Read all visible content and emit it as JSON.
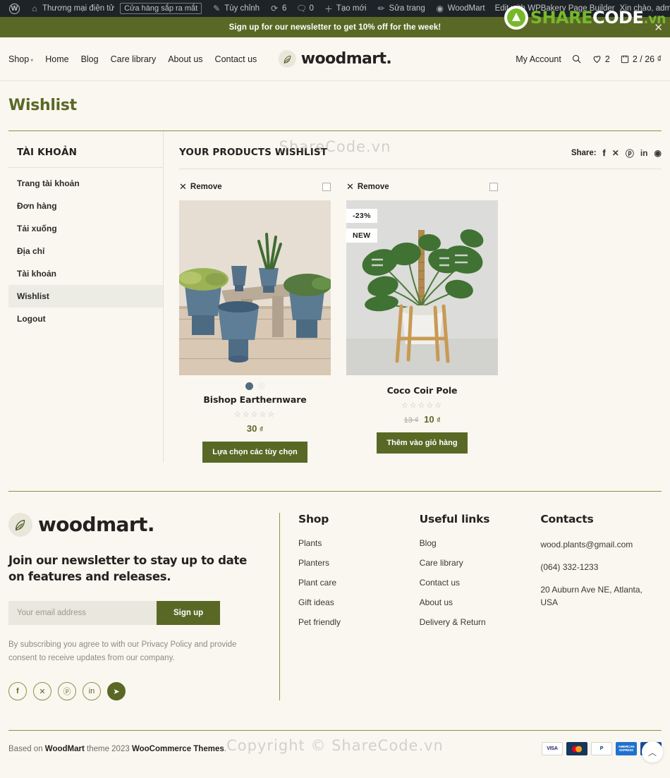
{
  "adminbar": {
    "items": [
      {
        "icon": "wordpress-icon",
        "label": ""
      },
      {
        "icon": "dashboard-icon",
        "label": "Thương mại điện tử",
        "pill": "Cửa hàng sắp ra mắt"
      },
      {
        "icon": "pencil-icon",
        "label": "Tùy chỉnh"
      },
      {
        "icon": "update-icon",
        "label": "6"
      },
      {
        "icon": "comment-icon",
        "label": "0"
      },
      {
        "icon": "plus-icon",
        "label": "Tạo mới"
      },
      {
        "icon": "edit-icon",
        "label": "Sửa trang"
      },
      {
        "icon": "woodmart-icon",
        "label": "WoodMart"
      },
      {
        "icon": "",
        "label": "Edit with WPBakery Page Builder"
      }
    ],
    "greeting": "Xin chào, admin",
    "search_icon": "search-icon"
  },
  "promo": {
    "text": "Sign up for our newsletter to get 10% off for the week!",
    "close": "✕"
  },
  "watermark": {
    "share": "SHARE",
    "code": "CODE",
    "vn": ".vn",
    "center_top": "ShareCode.vn",
    "center_bottom": "Copyright © ShareCode.vn"
  },
  "header": {
    "nav": [
      {
        "label": "Shop",
        "has_caret": true
      },
      {
        "label": "Home",
        "has_caret": false
      },
      {
        "label": "Blog",
        "has_caret": false
      },
      {
        "label": "Care library",
        "has_caret": false
      },
      {
        "label": "About us",
        "has_caret": false
      },
      {
        "label": "Contact us",
        "has_caret": false
      }
    ],
    "brand": "woodmart.",
    "my_account": "My Account",
    "wishlist_count": "2",
    "cart_summary": "2 / 26 ₫"
  },
  "page": {
    "title": "Wishlist"
  },
  "sidebar": {
    "heading": "TÀI KHOẢN",
    "items": [
      {
        "label": "Trang tài khoản",
        "active": false
      },
      {
        "label": "Đơn hàng",
        "active": false
      },
      {
        "label": "Tải xuống",
        "active": false
      },
      {
        "label": "Địa chỉ",
        "active": false
      },
      {
        "label": "Tài khoản",
        "active": false
      },
      {
        "label": "Wishlist",
        "active": true
      },
      {
        "label": "Logout",
        "active": false
      }
    ]
  },
  "wishlist": {
    "title": "YOUR PRODUCTS WISHLIST",
    "share_label": "Share:",
    "share_icons": [
      "facebook-icon",
      "x-icon",
      "pinterest-icon",
      "linkedin-icon",
      "telegram-icon"
    ],
    "remove_label": "Remove",
    "products": [
      {
        "name": "Bishop Earthernware",
        "badges": [],
        "swatches": [
          "#4f6c80",
          "#f2f1ea"
        ],
        "rating_stars": "☆☆☆☆☆",
        "price_old": "",
        "price": "30",
        "currency": "₫",
        "button": "Lựa chọn các tùy chọn"
      },
      {
        "name": "Coco Coir Pole",
        "badges": [
          "-23%",
          "NEW"
        ],
        "swatches": [],
        "rating_stars": "☆☆☆☆☆",
        "price_old": "13 ₫",
        "price": "10",
        "currency": "₫",
        "button": "Thêm vào giỏ hàng"
      }
    ]
  },
  "footer": {
    "brand": "woodmart.",
    "tagline": "Join our newsletter to stay up to date on features and releases.",
    "email_placeholder": "Your email address",
    "signup_label": "Sign up",
    "fineprint": "By subscribing you agree to with our Privacy Policy and provide consent to receive updates from our company.",
    "social": [
      "facebook-icon",
      "x-icon",
      "pinterest-icon",
      "linkedin-icon",
      "telegram-icon"
    ],
    "columns": [
      {
        "title": "Shop",
        "links": [
          "Plants",
          "Planters",
          "Plant care",
          "Gift ideas",
          "Pet friendly"
        ]
      },
      {
        "title": "Useful links",
        "links": [
          "Blog",
          "Care library",
          "Contact us",
          "About us",
          "Delivery & Return"
        ]
      }
    ],
    "contacts": {
      "title": "Contacts",
      "email": "wood.plants@gmail.com",
      "phone": "(064) 332-1233",
      "address": "20 Auburn Ave NE, Atlanta, USA"
    }
  },
  "bottom": {
    "prefix": "Based on ",
    "theme": "WoodMart",
    "middle": " theme 2023 ",
    "vendor": "WooCommerce Themes",
    "suffix": ".",
    "payments": [
      "VISA",
      "MasterCard",
      "PayPal",
      "American Express",
      "VISA Electron"
    ],
    "scrolltop_icon": "chevron-up-icon"
  },
  "colors": {
    "accent": "#5a6826",
    "bg": "#faf7f0",
    "rule": "#8b9243"
  }
}
